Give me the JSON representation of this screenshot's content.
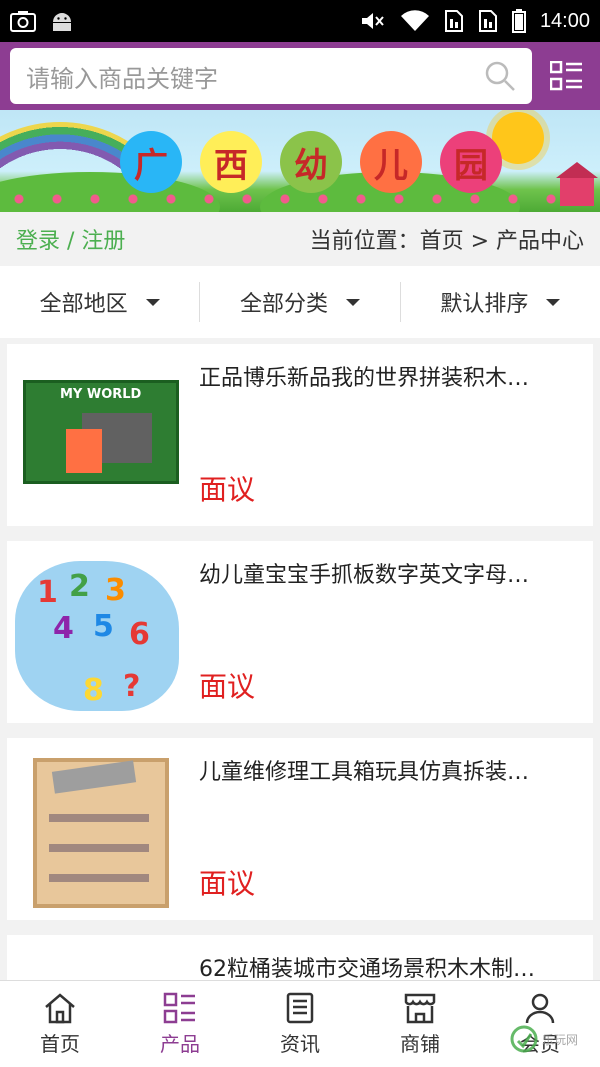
{
  "status_bar": {
    "time": "14:00"
  },
  "search": {
    "placeholder": "请输入商品关键字"
  },
  "banner": {
    "chars": [
      "广",
      "西",
      "幼",
      "儿",
      "园"
    ],
    "circle_colors": [
      "#29b6f6",
      "#ffee58",
      "#8bc34a",
      "#ff7043",
      "#ec407a"
    ]
  },
  "location": {
    "login": "登录 / 注册",
    "breadcrumb": "当前位置：首页 > 产品中心"
  },
  "filters": [
    "全部地区",
    "全部分类",
    "默认排序"
  ],
  "products": [
    {
      "name": "正品博乐新品我的世界拼装积木…",
      "price": "面议"
    },
    {
      "name": "幼儿童宝宝手抓板数字英文字母…",
      "price": "面议"
    },
    {
      "name": "儿童维修理工具箱玩具仿真拆装…",
      "price": "面议"
    },
    {
      "name": "62粒桶装城市交通场景积木木制…",
      "price": ""
    }
  ],
  "tabs": [
    {
      "label": "首页",
      "icon": "home-icon",
      "active": false
    },
    {
      "label": "产品",
      "icon": "grid-list-icon",
      "active": true
    },
    {
      "label": "资讯",
      "icon": "news-icon",
      "active": false
    },
    {
      "label": "商铺",
      "icon": "store-icon",
      "active": false
    },
    {
      "label": "会员",
      "icon": "user-icon",
      "active": false
    }
  ],
  "colors": {
    "brand": "#8d3d92",
    "price": "#e02020",
    "login": "#4caf50"
  },
  "watermark": {
    "text": "乐玩网"
  }
}
